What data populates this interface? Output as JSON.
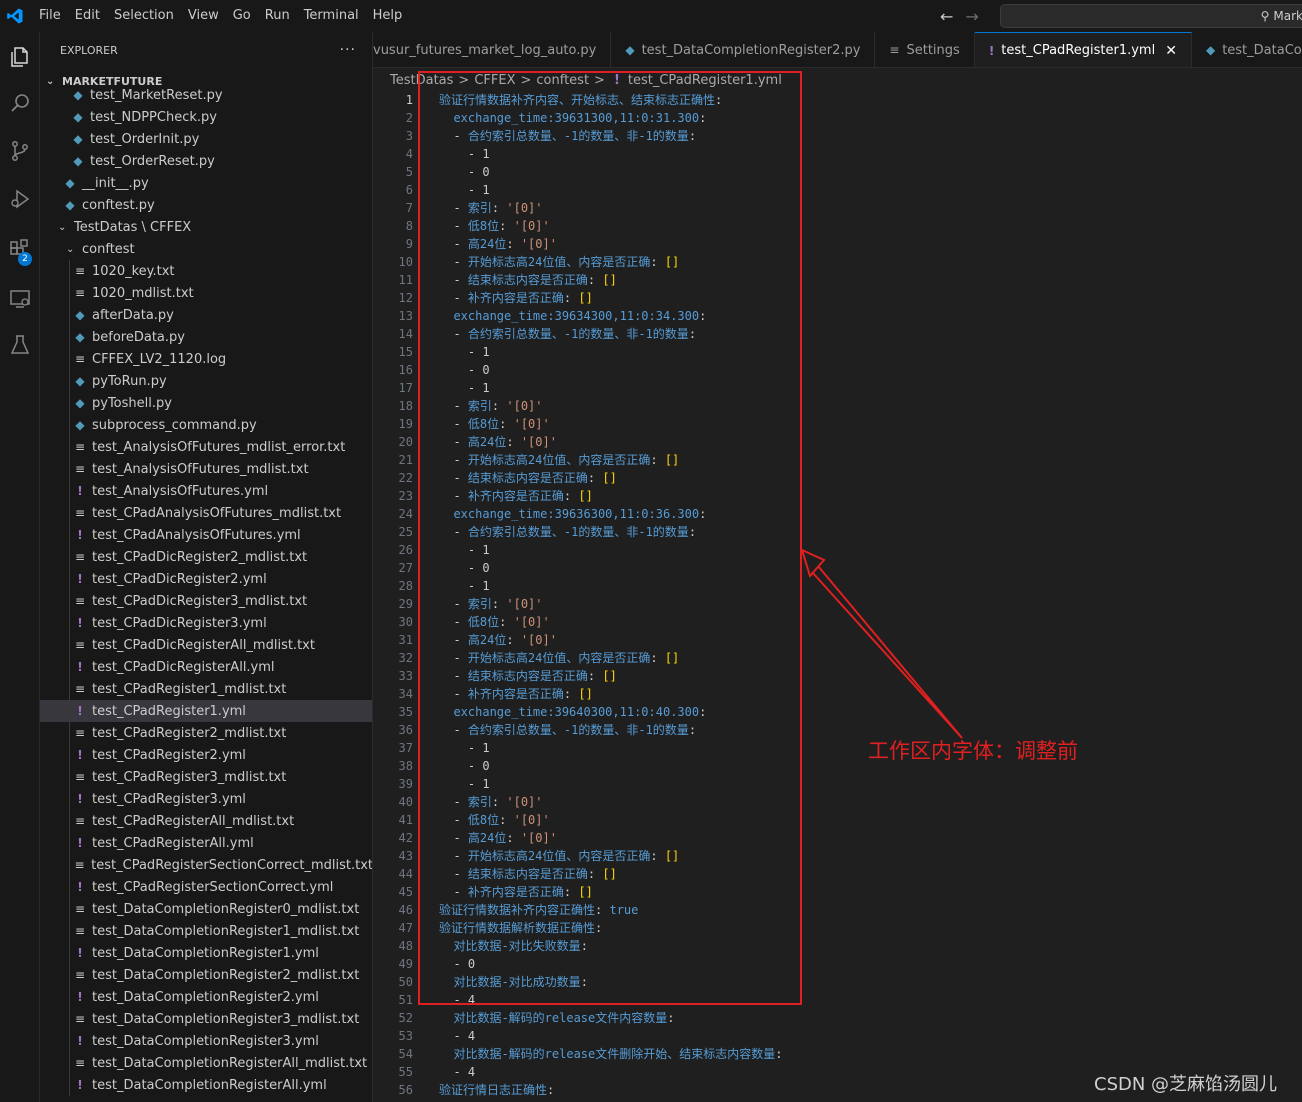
{
  "menu": [
    "File",
    "Edit",
    "Selection",
    "View",
    "Go",
    "Run",
    "Terminal",
    "Help"
  ],
  "command_center": "Mark",
  "activity": {
    "badge": "2",
    "icons": [
      "explorer-icon",
      "search-icon",
      "source-control-icon",
      "run-debug-icon",
      "extensions-icon",
      "remote-explorer-icon",
      "testing-icon"
    ]
  },
  "sidebar": {
    "title": "EXPLORER",
    "more": "···",
    "section": "MARKETFUTURE",
    "tree": [
      {
        "label": "test_MarketReset.py",
        "type": "py",
        "indent": 2
      },
      {
        "label": "test_NDPPCheck.py",
        "type": "py",
        "indent": 2
      },
      {
        "label": "test_OrderInit.py",
        "type": "py",
        "indent": 2
      },
      {
        "label": "test_OrderReset.py",
        "type": "py",
        "indent": 2
      },
      {
        "label": "__init__.py",
        "type": "py",
        "indent": 1
      },
      {
        "label": "conftest.py",
        "type": "py",
        "indent": 1
      },
      {
        "label": "TestDatas \\ CFFEX",
        "type": "folder",
        "indent": 1
      },
      {
        "label": "conftest",
        "type": "folder",
        "indent": 2
      },
      {
        "label": "1020_key.txt",
        "type": "txt",
        "indent": 3
      },
      {
        "label": "1020_mdlist.txt",
        "type": "txt",
        "indent": 3
      },
      {
        "label": "afterData.py",
        "type": "py",
        "indent": 3
      },
      {
        "label": "beforeData.py",
        "type": "py",
        "indent": 3
      },
      {
        "label": "CFFEX_LV2_1120.log",
        "type": "txt",
        "indent": 3
      },
      {
        "label": "pyToRun.py",
        "type": "py",
        "indent": 3
      },
      {
        "label": "pyToshell.py",
        "type": "py",
        "indent": 3
      },
      {
        "label": "subprocess_command.py",
        "type": "py",
        "indent": 3
      },
      {
        "label": "test_AnalysisOfFutures_mdlist_error.txt",
        "type": "txt",
        "indent": 3
      },
      {
        "label": "test_AnalysisOfFutures_mdlist.txt",
        "type": "txt",
        "indent": 3
      },
      {
        "label": "test_AnalysisOfFutures.yml",
        "type": "yml",
        "indent": 3
      },
      {
        "label": "test_CPadAnalysisOfFutures_mdlist.txt",
        "type": "txt",
        "indent": 3
      },
      {
        "label": "test_CPadAnalysisOfFutures.yml",
        "type": "yml",
        "indent": 3
      },
      {
        "label": "test_CPadDicRegister2_mdlist.txt",
        "type": "txt",
        "indent": 3
      },
      {
        "label": "test_CPadDicRegister2.yml",
        "type": "yml",
        "indent": 3
      },
      {
        "label": "test_CPadDicRegister3_mdlist.txt",
        "type": "txt",
        "indent": 3
      },
      {
        "label": "test_CPadDicRegister3.yml",
        "type": "yml",
        "indent": 3
      },
      {
        "label": "test_CPadDicRegisterAll_mdlist.txt",
        "type": "txt",
        "indent": 3
      },
      {
        "label": "test_CPadDicRegisterAll.yml",
        "type": "yml",
        "indent": 3
      },
      {
        "label": "test_CPadRegister1_mdlist.txt",
        "type": "txt",
        "indent": 3
      },
      {
        "label": "test_CPadRegister1.yml",
        "type": "yml",
        "indent": 3,
        "selected": true
      },
      {
        "label": "test_CPadRegister2_mdlist.txt",
        "type": "txt",
        "indent": 3
      },
      {
        "label": "test_CPadRegister2.yml",
        "type": "yml",
        "indent": 3
      },
      {
        "label": "test_CPadRegister3_mdlist.txt",
        "type": "txt",
        "indent": 3
      },
      {
        "label": "test_CPadRegister3.yml",
        "type": "yml",
        "indent": 3
      },
      {
        "label": "test_CPadRegisterAll_mdlist.txt",
        "type": "txt",
        "indent": 3
      },
      {
        "label": "test_CPadRegisterAll.yml",
        "type": "yml",
        "indent": 3
      },
      {
        "label": "test_CPadRegisterSectionCorrect_mdlist.txt",
        "type": "txt",
        "indent": 3
      },
      {
        "label": "test_CPadRegisterSectionCorrect.yml",
        "type": "yml",
        "indent": 3
      },
      {
        "label": "test_DataCompletionRegister0_mdlist.txt",
        "type": "txt",
        "indent": 3
      },
      {
        "label": "test_DataCompletionRegister1_mdlist.txt",
        "type": "txt",
        "indent": 3
      },
      {
        "label": "test_DataCompletionRegister1.yml",
        "type": "yml",
        "indent": 3
      },
      {
        "label": "test_DataCompletionRegister2_mdlist.txt",
        "type": "txt",
        "indent": 3
      },
      {
        "label": "test_DataCompletionRegister2.yml",
        "type": "yml",
        "indent": 3
      },
      {
        "label": "test_DataCompletionRegister3_mdlist.txt",
        "type": "txt",
        "indent": 3
      },
      {
        "label": "test_DataCompletionRegister3.yml",
        "type": "yml",
        "indent": 3
      },
      {
        "label": "test_DataCompletionRegisterAll_mdlist.txt",
        "type": "txt",
        "indent": 3
      },
      {
        "label": "test_DataCompletionRegisterAll.yml",
        "type": "yml",
        "indent": 3
      }
    ]
  },
  "tabs": [
    {
      "label": "vusur_futures_market_log_auto.py",
      "type": "none",
      "active": false
    },
    {
      "label": "test_DataCompletionRegister2.py",
      "type": "py",
      "active": false
    },
    {
      "label": "Settings",
      "type": "settings",
      "active": false
    },
    {
      "label": "test_CPadRegister1.yml",
      "type": "yml",
      "active": true
    },
    {
      "label": "test_DataCompletio",
      "type": "py",
      "active": false
    }
  ],
  "breadcrumb": [
    "TestDatas",
    "CFFEX",
    "conftest",
    "test_CPadRegister1.yml"
  ],
  "current_line": 1,
  "code_lines": [
    [
      [
        "k",
        "验证行情数据补齐内容、开始标志、结束标志正确性"
      ],
      [
        "d",
        ":"
      ]
    ],
    [
      [
        "d",
        "  "
      ],
      [
        "k",
        "exchange_time:39631300,11:0:31.300"
      ],
      [
        "d",
        ":"
      ]
    ],
    [
      [
        "d",
        "  - "
      ],
      [
        "k",
        "合约索引总数量、-1的数量、非-1的数量"
      ],
      [
        "d",
        ":"
      ]
    ],
    [
      [
        "d",
        "    - "
      ],
      [
        "d",
        "1"
      ]
    ],
    [
      [
        "d",
        "    - "
      ],
      [
        "d",
        "0"
      ]
    ],
    [
      [
        "d",
        "    - "
      ],
      [
        "d",
        "1"
      ]
    ],
    [
      [
        "d",
        "  - "
      ],
      [
        "k",
        "索引"
      ],
      [
        "d",
        ": "
      ],
      [
        "s",
        "'[0]'"
      ]
    ],
    [
      [
        "d",
        "  - "
      ],
      [
        "k",
        "低8位"
      ],
      [
        "d",
        ": "
      ],
      [
        "s",
        "'[0]'"
      ]
    ],
    [
      [
        "d",
        "  - "
      ],
      [
        "k",
        "高24位"
      ],
      [
        "d",
        ": "
      ],
      [
        "s",
        "'[0]'"
      ]
    ],
    [
      [
        "d",
        "  - "
      ],
      [
        "k",
        "开始标志高24位值、内容是否正确"
      ],
      [
        "d",
        ": "
      ],
      [
        "br",
        "[]"
      ]
    ],
    [
      [
        "d",
        "  - "
      ],
      [
        "k",
        "结束标志内容是否正确"
      ],
      [
        "d",
        ": "
      ],
      [
        "br",
        "[]"
      ]
    ],
    [
      [
        "d",
        "  - "
      ],
      [
        "k",
        "补齐内容是否正确"
      ],
      [
        "d",
        ": "
      ],
      [
        "br",
        "[]"
      ]
    ],
    [
      [
        "d",
        "  "
      ],
      [
        "k",
        "exchange_time:39634300,11:0:34.300"
      ],
      [
        "d",
        ":"
      ]
    ],
    [
      [
        "d",
        "  - "
      ],
      [
        "k",
        "合约索引总数量、-1的数量、非-1的数量"
      ],
      [
        "d",
        ":"
      ]
    ],
    [
      [
        "d",
        "    - "
      ],
      [
        "d",
        "1"
      ]
    ],
    [
      [
        "d",
        "    - "
      ],
      [
        "d",
        "0"
      ]
    ],
    [
      [
        "d",
        "    - "
      ],
      [
        "d",
        "1"
      ]
    ],
    [
      [
        "d",
        "  - "
      ],
      [
        "k",
        "索引"
      ],
      [
        "d",
        ": "
      ],
      [
        "s",
        "'[0]'"
      ]
    ],
    [
      [
        "d",
        "  - "
      ],
      [
        "k",
        "低8位"
      ],
      [
        "d",
        ": "
      ],
      [
        "s",
        "'[0]'"
      ]
    ],
    [
      [
        "d",
        "  - "
      ],
      [
        "k",
        "高24位"
      ],
      [
        "d",
        ": "
      ],
      [
        "s",
        "'[0]'"
      ]
    ],
    [
      [
        "d",
        "  - "
      ],
      [
        "k",
        "开始标志高24位值、内容是否正确"
      ],
      [
        "d",
        ": "
      ],
      [
        "br",
        "[]"
      ]
    ],
    [
      [
        "d",
        "  - "
      ],
      [
        "k",
        "结束标志内容是否正确"
      ],
      [
        "d",
        ": "
      ],
      [
        "br",
        "[]"
      ]
    ],
    [
      [
        "d",
        "  - "
      ],
      [
        "k",
        "补齐内容是否正确"
      ],
      [
        "d",
        ": "
      ],
      [
        "br",
        "[]"
      ]
    ],
    [
      [
        "d",
        "  "
      ],
      [
        "k",
        "exchange_time:39636300,11:0:36.300"
      ],
      [
        "d",
        ":"
      ]
    ],
    [
      [
        "d",
        "  - "
      ],
      [
        "k",
        "合约索引总数量、-1的数量、非-1的数量"
      ],
      [
        "d",
        ":"
      ]
    ],
    [
      [
        "d",
        "    - "
      ],
      [
        "d",
        "1"
      ]
    ],
    [
      [
        "d",
        "    - "
      ],
      [
        "d",
        "0"
      ]
    ],
    [
      [
        "d",
        "    - "
      ],
      [
        "d",
        "1"
      ]
    ],
    [
      [
        "d",
        "  - "
      ],
      [
        "k",
        "索引"
      ],
      [
        "d",
        ": "
      ],
      [
        "s",
        "'[0]'"
      ]
    ],
    [
      [
        "d",
        "  - "
      ],
      [
        "k",
        "低8位"
      ],
      [
        "d",
        ": "
      ],
      [
        "s",
        "'[0]'"
      ]
    ],
    [
      [
        "d",
        "  - "
      ],
      [
        "k",
        "高24位"
      ],
      [
        "d",
        ": "
      ],
      [
        "s",
        "'[0]'"
      ]
    ],
    [
      [
        "d",
        "  - "
      ],
      [
        "k",
        "开始标志高24位值、内容是否正确"
      ],
      [
        "d",
        ": "
      ],
      [
        "br",
        "[]"
      ]
    ],
    [
      [
        "d",
        "  - "
      ],
      [
        "k",
        "结束标志内容是否正确"
      ],
      [
        "d",
        ": "
      ],
      [
        "br",
        "[]"
      ]
    ],
    [
      [
        "d",
        "  - "
      ],
      [
        "k",
        "补齐内容是否正确"
      ],
      [
        "d",
        ": "
      ],
      [
        "br",
        "[]"
      ]
    ],
    [
      [
        "d",
        "  "
      ],
      [
        "k",
        "exchange_time:39640300,11:0:40.300"
      ],
      [
        "d",
        ":"
      ]
    ],
    [
      [
        "d",
        "  - "
      ],
      [
        "k",
        "合约索引总数量、-1的数量、非-1的数量"
      ],
      [
        "d",
        ":"
      ]
    ],
    [
      [
        "d",
        "    - "
      ],
      [
        "d",
        "1"
      ]
    ],
    [
      [
        "d",
        "    - "
      ],
      [
        "d",
        "0"
      ]
    ],
    [
      [
        "d",
        "    - "
      ],
      [
        "d",
        "1"
      ]
    ],
    [
      [
        "d",
        "  - "
      ],
      [
        "k",
        "索引"
      ],
      [
        "d",
        ": "
      ],
      [
        "s",
        "'[0]'"
      ]
    ],
    [
      [
        "d",
        "  - "
      ],
      [
        "k",
        "低8位"
      ],
      [
        "d",
        ": "
      ],
      [
        "s",
        "'[0]'"
      ]
    ],
    [
      [
        "d",
        "  - "
      ],
      [
        "k",
        "高24位"
      ],
      [
        "d",
        ": "
      ],
      [
        "s",
        "'[0]'"
      ]
    ],
    [
      [
        "d",
        "  - "
      ],
      [
        "k",
        "开始标志高24位值、内容是否正确"
      ],
      [
        "d",
        ": "
      ],
      [
        "br",
        "[]"
      ]
    ],
    [
      [
        "d",
        "  - "
      ],
      [
        "k",
        "结束标志内容是否正确"
      ],
      [
        "d",
        ": "
      ],
      [
        "br",
        "[]"
      ]
    ],
    [
      [
        "d",
        "  - "
      ],
      [
        "k",
        "补齐内容是否正确"
      ],
      [
        "d",
        ": "
      ],
      [
        "br",
        "[]"
      ]
    ],
    [
      [
        "k",
        "验证行情数据补齐内容正确性"
      ],
      [
        "d",
        ": "
      ],
      [
        "b",
        "true"
      ]
    ],
    [
      [
        "k",
        "验证行情数据解析数据正确性"
      ],
      [
        "d",
        ":"
      ]
    ],
    [
      [
        "d",
        "  "
      ],
      [
        "k",
        "对比数据-对比失败数量"
      ],
      [
        "d",
        ":"
      ]
    ],
    [
      [
        "d",
        "  - "
      ],
      [
        "d",
        "0"
      ]
    ],
    [
      [
        "d",
        "  "
      ],
      [
        "k",
        "对比数据-对比成功数量"
      ],
      [
        "d",
        ":"
      ]
    ],
    [
      [
        "d",
        "  - "
      ],
      [
        "d",
        "4"
      ]
    ],
    [
      [
        "d",
        "  "
      ],
      [
        "k",
        "对比数据-解码的release文件内容数量"
      ],
      [
        "d",
        ":"
      ]
    ],
    [
      [
        "d",
        "  - "
      ],
      [
        "d",
        "4"
      ]
    ],
    [
      [
        "d",
        "  "
      ],
      [
        "k",
        "对比数据-解码的release文件删除开始、结束标志内容数量"
      ],
      [
        "d",
        ":"
      ]
    ],
    [
      [
        "d",
        "  - "
      ],
      [
        "d",
        "4"
      ]
    ],
    [
      [
        "k",
        "验证行情日志正确性"
      ],
      [
        "d",
        ":"
      ]
    ]
  ],
  "annotation": "工作区内字体：调整前",
  "watermark": "CSDN @芝麻馅汤圆儿",
  "colors": {
    "annotation": "#e02020",
    "key": "#569cd6",
    "string": "#ce9178",
    "bracket": "#ffd700",
    "py_icon": "#519aba",
    "yml_icon": "#a074c4"
  }
}
